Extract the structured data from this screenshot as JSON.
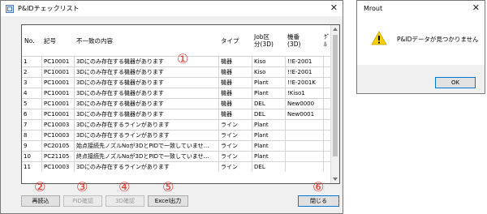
{
  "main_window": {
    "title": "P&IDチェックリスト",
    "close_glyph": "✕"
  },
  "table": {
    "columns": [
      "No.",
      "記号",
      "不一致の内容",
      "タイプ",
      "Job区\n分(3D)",
      "機番\n(3D)",
      "ｸﾞ\nﾙ"
    ],
    "rows": [
      [
        "1",
        "PC10001",
        "3Dにのみ存在する機器があります",
        "機器",
        "Kiso",
        "!!E-2001"
      ],
      [
        "2",
        "PC10001",
        "3Dにのみ存在する機器があります",
        "機器",
        "Kiso",
        "!!E-2001"
      ],
      [
        "3",
        "PC10001",
        "3Dにのみ存在する機器があります",
        "機器",
        "Plant",
        "!!E-2001K"
      ],
      [
        "4",
        "PC10001",
        "3Dにのみ存在する機器があります",
        "機器",
        "Plant",
        "!Kiso1"
      ],
      [
        "5",
        "PC10001",
        "3Dにのみ存在する機器があります",
        "機器",
        "DEL",
        "New0000"
      ],
      [
        "6",
        "PC10001",
        "3Dにのみ存在する機器があります",
        "機器",
        "DEL",
        "New0001"
      ],
      [
        "7",
        "PC10003",
        "3Dにのみ存在するラインがあります",
        "ライン",
        "Plant",
        ""
      ],
      [
        "8",
        "PC10003",
        "3Dにのみ存在するラインがあります",
        "ライン",
        "Plant",
        ""
      ],
      [
        "9",
        "PC20105",
        "始点接続先ノズルNoが3DとPIDで一致していませ…",
        "ライン",
        "Plant",
        ""
      ],
      [
        "10",
        "PC21105",
        "終点接続先ノズルNoが3DとPIDで一致していませ…",
        "ライン",
        "Plant",
        ""
      ],
      [
        "11",
        "PC10003",
        "3Dにのみ存在するラインがあります",
        "ライン",
        "DEL",
        ""
      ]
    ]
  },
  "buttons": {
    "reload": "再読込",
    "pid_check": "PID確認",
    "check_3d": "3D確認",
    "excel_export": "Excel出力",
    "close": "閉じる"
  },
  "markers": [
    "①",
    "②",
    "③",
    "④",
    "⑤",
    "⑥"
  ],
  "marker_color": "#e8362b",
  "message_box": {
    "title": "Mrout",
    "message": "P&IDデータが見つかりません",
    "ok": "OK",
    "icon": "warning-icon",
    "close_glyph": "✕"
  }
}
